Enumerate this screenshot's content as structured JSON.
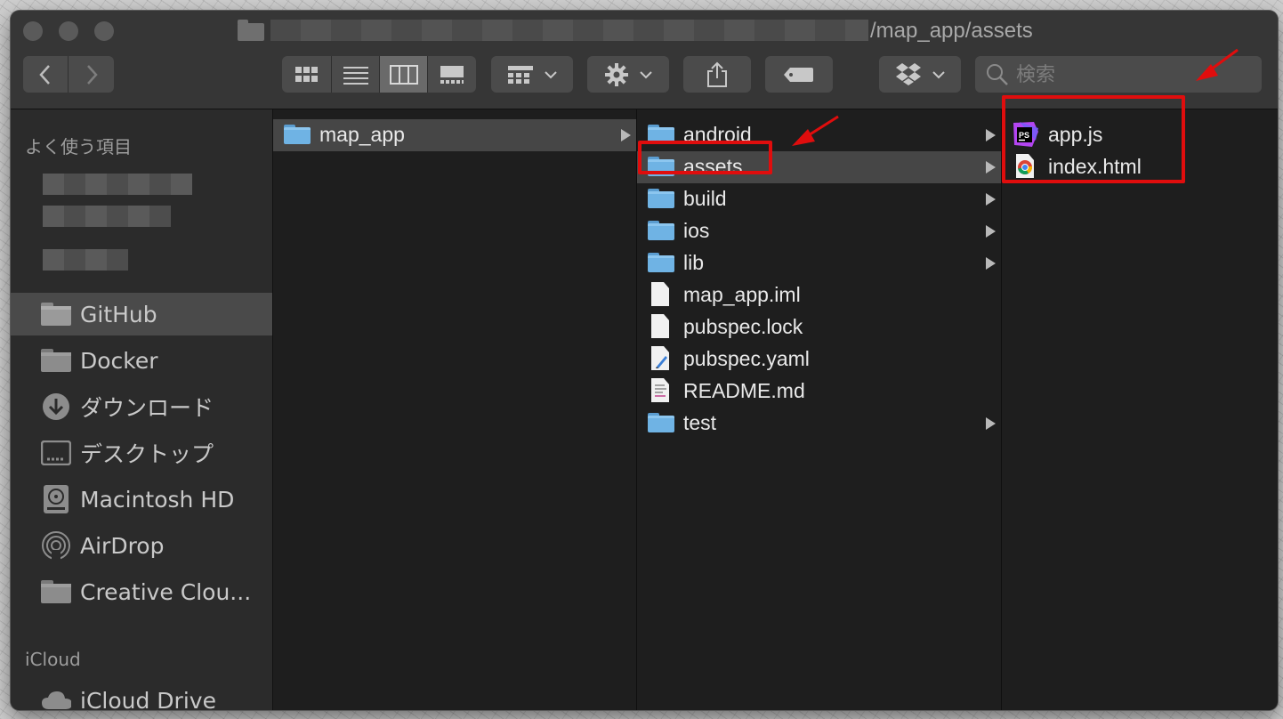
{
  "window": {
    "path_text": "/map_app/assets"
  },
  "toolbar": {
    "back_icon": "chevron-left-icon",
    "forward_icon": "chevron-right-icon",
    "view_icons": [
      "grid-view-icon",
      "list-view-icon",
      "column-view-icon",
      "gallery-view-icon"
    ],
    "group_icon": "group-grid-icon",
    "action_icon": "gear-icon",
    "share_icon": "share-icon",
    "tag_icon": "tag-icon",
    "dropbox_icon": "dropbox-icon",
    "search_placeholder": "検索"
  },
  "sidebar": {
    "favorites_header": "よく使う項目",
    "items": [
      {
        "label": "GitHub",
        "icon": "folder-icon",
        "selected": true
      },
      {
        "label": "Docker",
        "icon": "folder-icon"
      },
      {
        "label": "ダウンロード",
        "icon": "download-icon"
      },
      {
        "label": "デスクトップ",
        "icon": "desktop-icon"
      },
      {
        "label": "Macintosh HD",
        "icon": "disk-icon"
      },
      {
        "label": "AirDrop",
        "icon": "airdrop-icon"
      },
      {
        "label": "Creative Clou...",
        "icon": "folder-icon"
      }
    ],
    "icloud_header": "iCloud",
    "icloud_items": [
      {
        "label": "iCloud Drive",
        "icon": "cloud-icon"
      }
    ]
  },
  "columns": {
    "col1": [
      {
        "name": "map_app",
        "type": "folder",
        "selected": true
      }
    ],
    "col2": [
      {
        "name": "android",
        "type": "folder"
      },
      {
        "name": "assets",
        "type": "folder",
        "selected": true
      },
      {
        "name": "build",
        "type": "folder"
      },
      {
        "name": "ios",
        "type": "folder"
      },
      {
        "name": "lib",
        "type": "folder"
      },
      {
        "name": "map_app.iml",
        "type": "file"
      },
      {
        "name": "pubspec.lock",
        "type": "file"
      },
      {
        "name": "pubspec.yaml",
        "type": "yaml-file"
      },
      {
        "name": "README.md",
        "type": "markdown-file"
      },
      {
        "name": "test",
        "type": "folder"
      }
    ],
    "col3": [
      {
        "name": "app.js",
        "type": "phpstorm-file",
        "icon_text": "PS"
      },
      {
        "name": "index.html",
        "type": "chrome-html-file"
      }
    ]
  },
  "colors": {
    "highlight_red": "#e00d0d",
    "folder_blue": "#6fb3e4",
    "window_bg": "#1e1e1e"
  }
}
